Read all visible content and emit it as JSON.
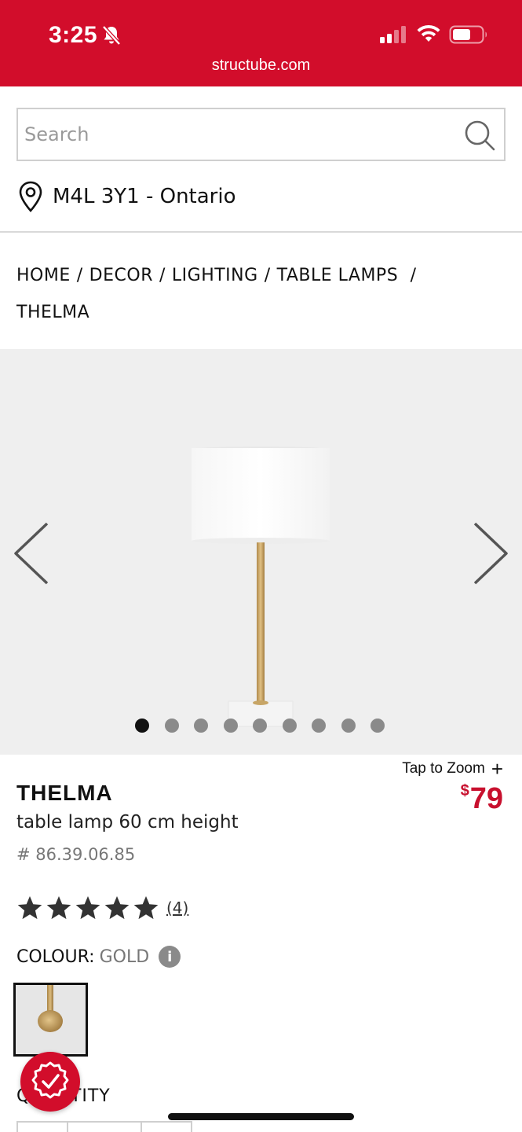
{
  "status_bar": {
    "time": "3:25",
    "url": "structube.com"
  },
  "search": {
    "placeholder": "Search"
  },
  "location": {
    "text": "M4L 3Y1 - Ontario"
  },
  "breadcrumb": {
    "items": [
      "HOME",
      "DECOR",
      "LIGHTING",
      "TABLE LAMPS",
      "THELMA"
    ],
    "separator": "/"
  },
  "gallery": {
    "total_images": 9,
    "active_index": 0
  },
  "product": {
    "tap_to_zoom": "Tap to Zoom",
    "zoom_symbol": "+",
    "currency": "$",
    "price": "79",
    "name": "THELMA",
    "description": "table lamp 60 cm height",
    "sku": "# 86.39.06.85",
    "rating_stars": 5,
    "review_count": "(4)",
    "colour_label": "COLOUR:",
    "colour_value": "GOLD",
    "quantity_label": "QUANTITY"
  },
  "colors": {
    "brand_red": "#d20d2b",
    "price_red": "#c8102e"
  }
}
